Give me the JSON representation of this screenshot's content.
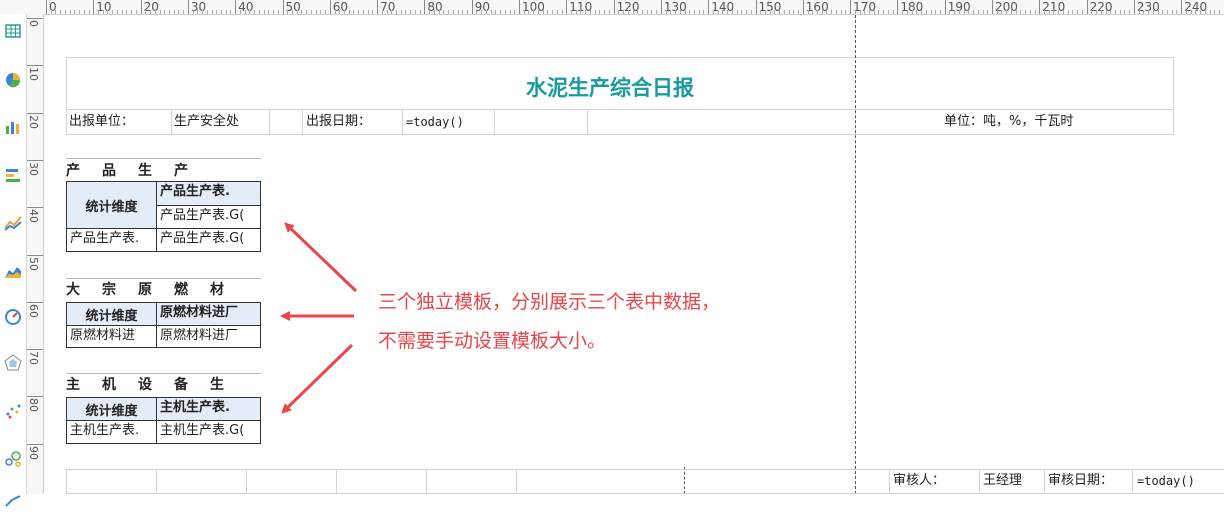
{
  "ruler": {
    "labels": [
      "0",
      "10",
      "20",
      "30",
      "40",
      "50",
      "60",
      "70",
      "80",
      "90",
      "100",
      "110",
      "120",
      "130",
      "140",
      "150",
      "160",
      "170",
      "180",
      "190",
      "200",
      "210",
      "220",
      "230",
      "240"
    ],
    "vlabels": [
      "0",
      "10",
      "20",
      "30",
      "40",
      "50",
      "60",
      "70",
      "80",
      "90"
    ]
  },
  "toolbar": {
    "icons": [
      "table-icon",
      "pie-chart-icon",
      "bar-chart-icon",
      "horizontal-bar-icon",
      "line-chart-icon",
      "area-chart-icon",
      "gauge-icon",
      "radar-icon",
      "scatter-icon",
      "bubble-icon",
      "more-chart-icon"
    ]
  },
  "report": {
    "title": "水泥生产综合日报",
    "unit_label": "出报单位：",
    "unit_value": "生产安全处",
    "date_label": "出报日期：",
    "date_value": "=today()",
    "measure_unit": "单位：吨，%，千瓦时"
  },
  "templates": [
    {
      "header": "产　品　生　产",
      "dim": "统计维度",
      "col_header": "产品生产表.",
      "col_sub": "产品生产表.G(",
      "row_dim": "产品生产表.",
      "row_val": "产品生产表.G("
    },
    {
      "header": "大　宗　原　燃　材",
      "dim": "统计维度",
      "col_header": "原燃材料进厂",
      "col_sub": "",
      "row_dim": "原燃材料进",
      "row_val": "原燃材料进厂"
    },
    {
      "header": "主　机　设　备　生",
      "dim": "统计维度",
      "col_header": "主机生产表.",
      "col_sub": "",
      "row_dim": "主机生产表.",
      "row_val": "主机生产表.G("
    }
  ],
  "annotation": {
    "line1": "三个独立模板，分别展示三个表中数据，",
    "line2": "不需要手动设置模板大小。",
    "color": "#e8464a"
  },
  "footer": {
    "reviewer_label": "审核人：",
    "reviewer_value": "王经理",
    "review_date_label": "审核日期：",
    "review_date_value": "=today()"
  },
  "colors": {
    "title": "#1a9aa0",
    "template_fill": "#e4ecf7",
    "annotation": "#e8464a"
  }
}
